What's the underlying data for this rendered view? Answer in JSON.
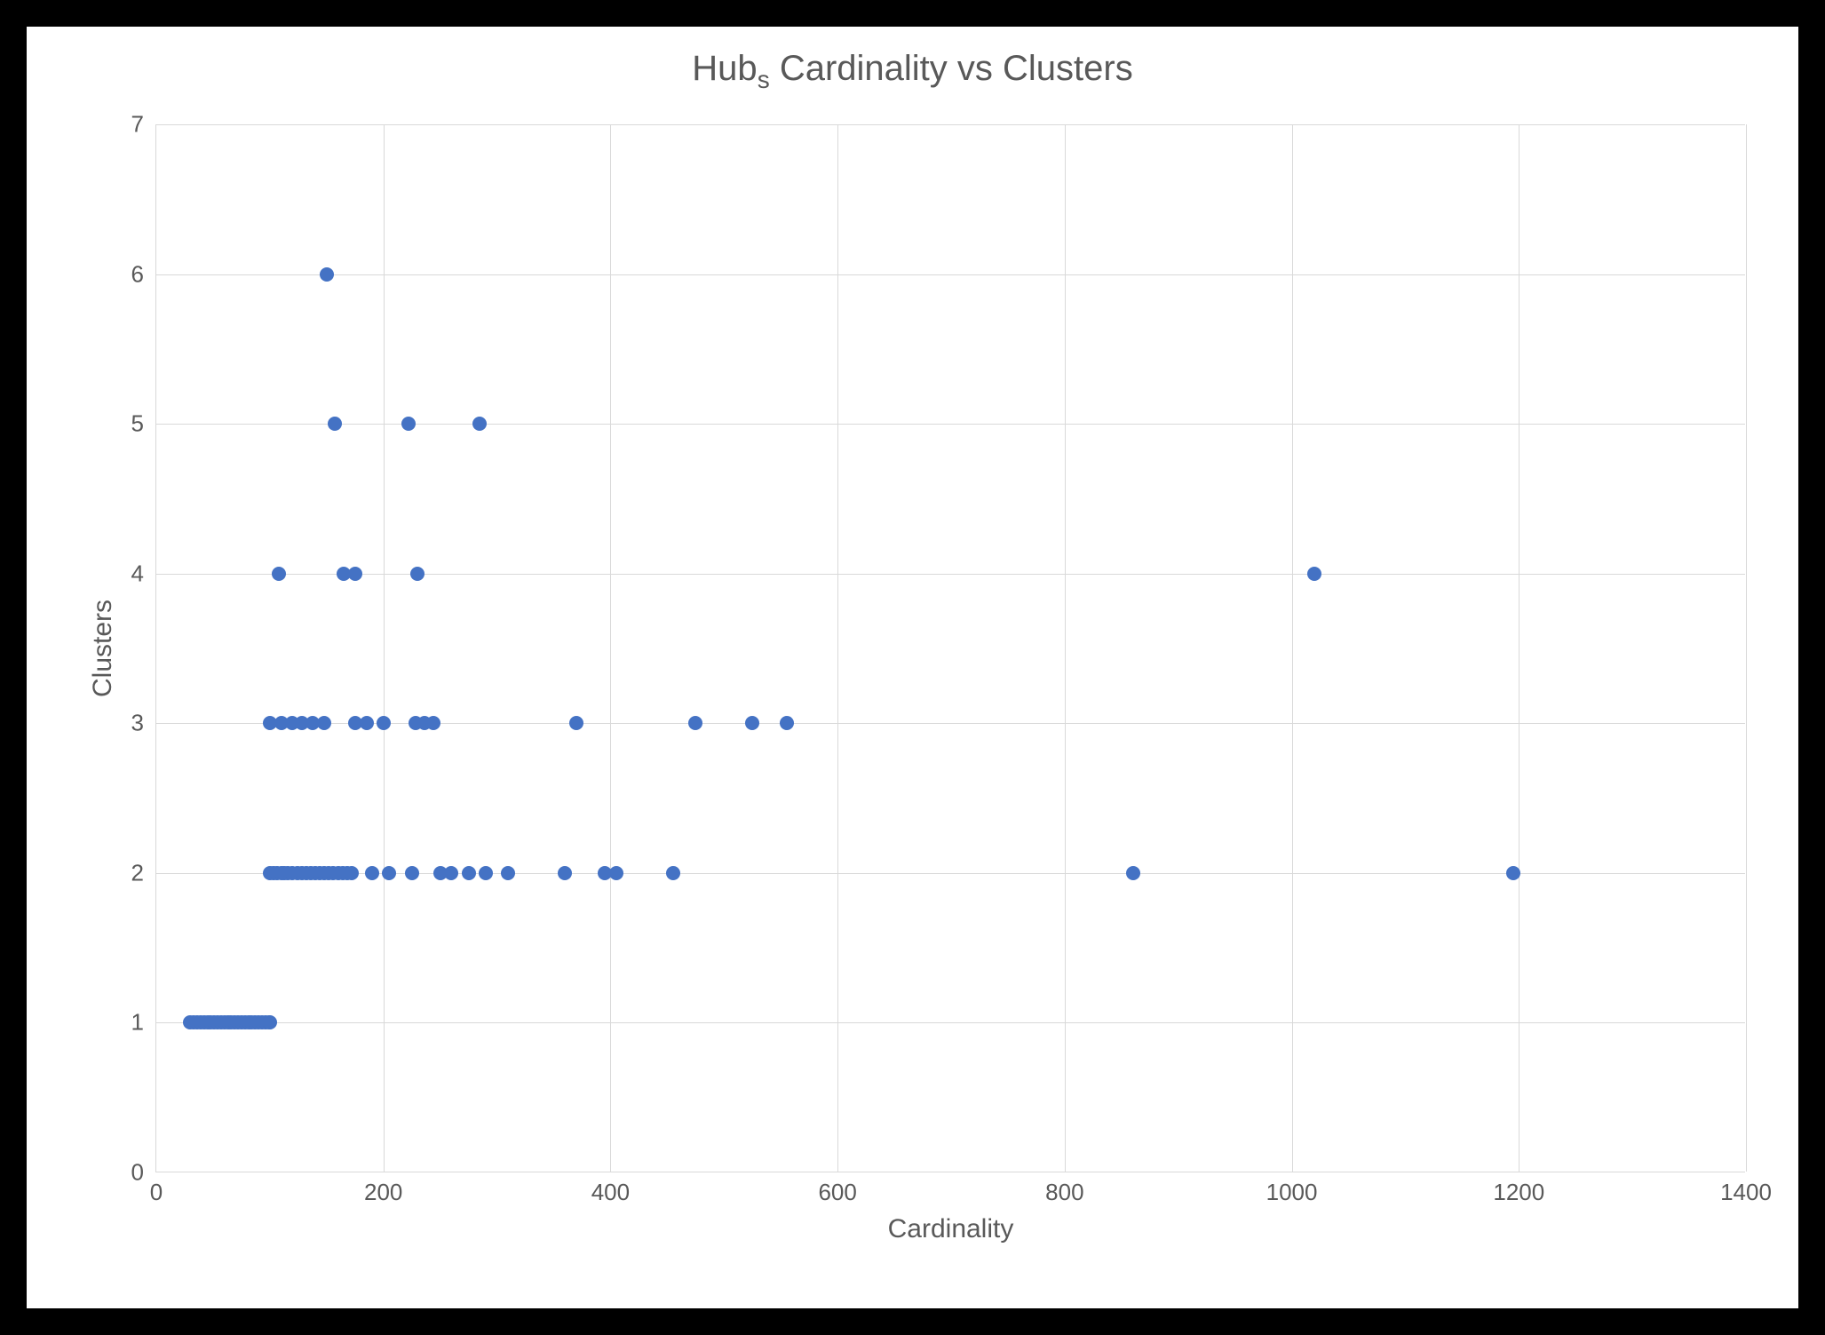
{
  "chart_data": {
    "type": "scatter",
    "title": "Hubₛ Cardinality vs Clusters",
    "xlabel": "Cardinality",
    "ylabel": "Clusters",
    "xlim": [
      0,
      1400
    ],
    "ylim": [
      0,
      7
    ],
    "xticks": [
      0,
      200,
      400,
      600,
      800,
      1000,
      1200,
      1400
    ],
    "yticks": [
      0,
      1,
      2,
      3,
      4,
      5,
      6,
      7
    ],
    "series": [
      {
        "name": "Hubs",
        "color": "#4472C4",
        "points": [
          [
            30,
            1
          ],
          [
            33,
            1
          ],
          [
            36,
            1
          ],
          [
            39,
            1
          ],
          [
            42,
            1
          ],
          [
            45,
            1
          ],
          [
            48,
            1
          ],
          [
            51,
            1
          ],
          [
            54,
            1
          ],
          [
            57,
            1
          ],
          [
            60,
            1
          ],
          [
            63,
            1
          ],
          [
            66,
            1
          ],
          [
            69,
            1
          ],
          [
            72,
            1
          ],
          [
            75,
            1
          ],
          [
            78,
            1
          ],
          [
            81,
            1
          ],
          [
            84,
            1
          ],
          [
            87,
            1
          ],
          [
            90,
            1
          ],
          [
            93,
            1
          ],
          [
            96,
            1
          ],
          [
            99,
            1
          ],
          [
            100,
            1
          ],
          [
            100,
            2
          ],
          [
            103,
            2
          ],
          [
            106,
            2
          ],
          [
            110,
            2
          ],
          [
            113,
            2
          ],
          [
            116,
            2
          ],
          [
            120,
            2
          ],
          [
            124,
            2
          ],
          [
            128,
            2
          ],
          [
            132,
            2
          ],
          [
            136,
            2
          ],
          [
            140,
            2
          ],
          [
            144,
            2
          ],
          [
            148,
            2
          ],
          [
            152,
            2
          ],
          [
            156,
            2
          ],
          [
            160,
            2
          ],
          [
            164,
            2
          ],
          [
            168,
            2
          ],
          [
            172,
            2
          ],
          [
            190,
            2
          ],
          [
            205,
            2
          ],
          [
            225,
            2
          ],
          [
            250,
            2
          ],
          [
            260,
            2
          ],
          [
            275,
            2
          ],
          [
            290,
            2
          ],
          [
            310,
            2
          ],
          [
            360,
            2
          ],
          [
            395,
            2
          ],
          [
            405,
            2
          ],
          [
            455,
            2
          ],
          [
            860,
            2
          ],
          [
            1195,
            2
          ],
          [
            100,
            3
          ],
          [
            110,
            3
          ],
          [
            120,
            3
          ],
          [
            128,
            3
          ],
          [
            138,
            3
          ],
          [
            148,
            3
          ],
          [
            175,
            3
          ],
          [
            185,
            3
          ],
          [
            200,
            3
          ],
          [
            228,
            3
          ],
          [
            236,
            3
          ],
          [
            244,
            3
          ],
          [
            370,
            3
          ],
          [
            475,
            3
          ],
          [
            525,
            3
          ],
          [
            555,
            3
          ],
          [
            108,
            4
          ],
          [
            165,
            4
          ],
          [
            175,
            4
          ],
          [
            230,
            4
          ],
          [
            1020,
            4
          ],
          [
            157,
            5
          ],
          [
            222,
            5
          ],
          [
            285,
            5
          ],
          [
            150,
            6
          ]
        ]
      }
    ]
  }
}
